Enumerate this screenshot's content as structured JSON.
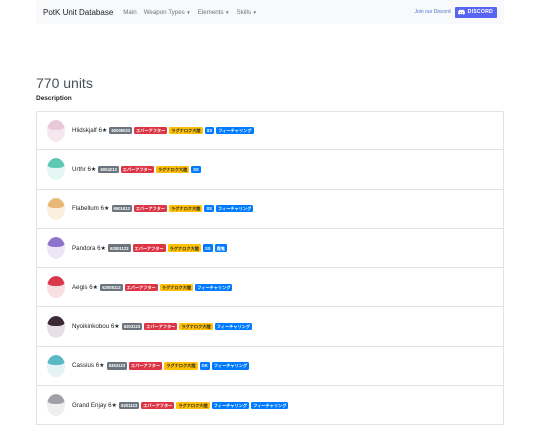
{
  "navbar": {
    "brand": "PotK Unit Database",
    "items": [
      {
        "label": "Main",
        "dropdown": false
      },
      {
        "label": "Weapon Types",
        "dropdown": true
      },
      {
        "label": "Elements",
        "dropdown": true
      },
      {
        "label": "Skills",
        "dropdown": true
      }
    ],
    "join_label": "Join our Discord",
    "discord_label": "DISCORD"
  },
  "summary": {
    "count": "770 units",
    "description": "Description"
  },
  "units": [
    {
      "name": "Hlidskjalf 6★",
      "id": "62005023",
      "tags": [
        {
          "label": "エバーアフター",
          "color": "red"
        },
        {
          "label": "ラグナロク大陸",
          "color": "yellow"
        },
        {
          "label": "SS",
          "color": "blue"
        },
        {
          "label": "フィーチャリング",
          "color": "blue"
        }
      ],
      "avatar": {
        "hair": "#e8c9d6",
        "bg": "#f6e6ee"
      }
    },
    {
      "name": "Urthr 6★",
      "id": "6004213",
      "tags": [
        {
          "label": "エバーアフター",
          "color": "red"
        },
        {
          "label": "ラグナロク大陸",
          "color": "yellow"
        },
        {
          "label": "SS",
          "color": "blue"
        }
      ],
      "avatar": {
        "hair": "#5fc9b5",
        "bg": "#e4f6f1"
      }
    },
    {
      "name": "Flabellum 6★",
      "id": "6501613",
      "tags": [
        {
          "label": "エバーアフター",
          "color": "red"
        },
        {
          "label": "ラグナロク大陸",
          "color": "yellow"
        },
        {
          "label": "SS",
          "color": "blue"
        },
        {
          "label": "フィーチャリング",
          "color": "blue"
        }
      ],
      "avatar": {
        "hair": "#e8b877",
        "bg": "#fbefe0"
      }
    },
    {
      "name": "Pandora 6★",
      "id": "62001123",
      "tags": [
        {
          "label": "エバーアフター",
          "color": "red"
        },
        {
          "label": "ラグナロク大陸",
          "color": "yellow"
        },
        {
          "label": "SS",
          "color": "blue"
        },
        {
          "label": "鹿鬼",
          "color": "blue"
        }
      ],
      "avatar": {
        "hair": "#8b74c9",
        "bg": "#ece6f7"
      }
    },
    {
      "name": "Aegis 6★",
      "id": "62008113",
      "tags": [
        {
          "label": "エバーアフター",
          "color": "red"
        },
        {
          "label": "ラグナロク大陸",
          "color": "yellow"
        },
        {
          "label": "フィーチャリング",
          "color": "blue"
        }
      ],
      "avatar": {
        "hair": "#d83a4a",
        "bg": "#f8e0e2"
      }
    },
    {
      "name": "Nyoikinkobou 6★",
      "id": "6203123",
      "tags": [
        {
          "label": "エバーアフター",
          "color": "red"
        },
        {
          "label": "ラグナロク大陸",
          "color": "yellow"
        },
        {
          "label": "フィーチャリング",
          "color": "blue"
        }
      ],
      "avatar": {
        "hair": "#3a2a35",
        "bg": "#e8e0e4"
      }
    },
    {
      "name": "Cassius 6★",
      "id": "6363123",
      "tags": [
        {
          "label": "エバーアフター",
          "color": "red"
        },
        {
          "label": "ラグナロク大陸",
          "color": "yellow"
        },
        {
          "label": "GK",
          "color": "blue"
        },
        {
          "label": "フィーチャリング",
          "color": "blue"
        }
      ],
      "avatar": {
        "hair": "#5ab7c4",
        "bg": "#e2f2f5"
      }
    },
    {
      "name": "Grand Enjay 6★",
      "id": "6201123",
      "tags": [
        {
          "label": "エバーアフター",
          "color": "red"
        },
        {
          "label": "ラグナロク大陸",
          "color": "yellow"
        },
        {
          "label": "フィーチャリング",
          "color": "blue"
        },
        {
          "label": "フィーチャリング",
          "color": "blue"
        }
      ],
      "avatar": {
        "hair": "#a0a0a8",
        "bg": "#eeeef0"
      }
    }
  ]
}
